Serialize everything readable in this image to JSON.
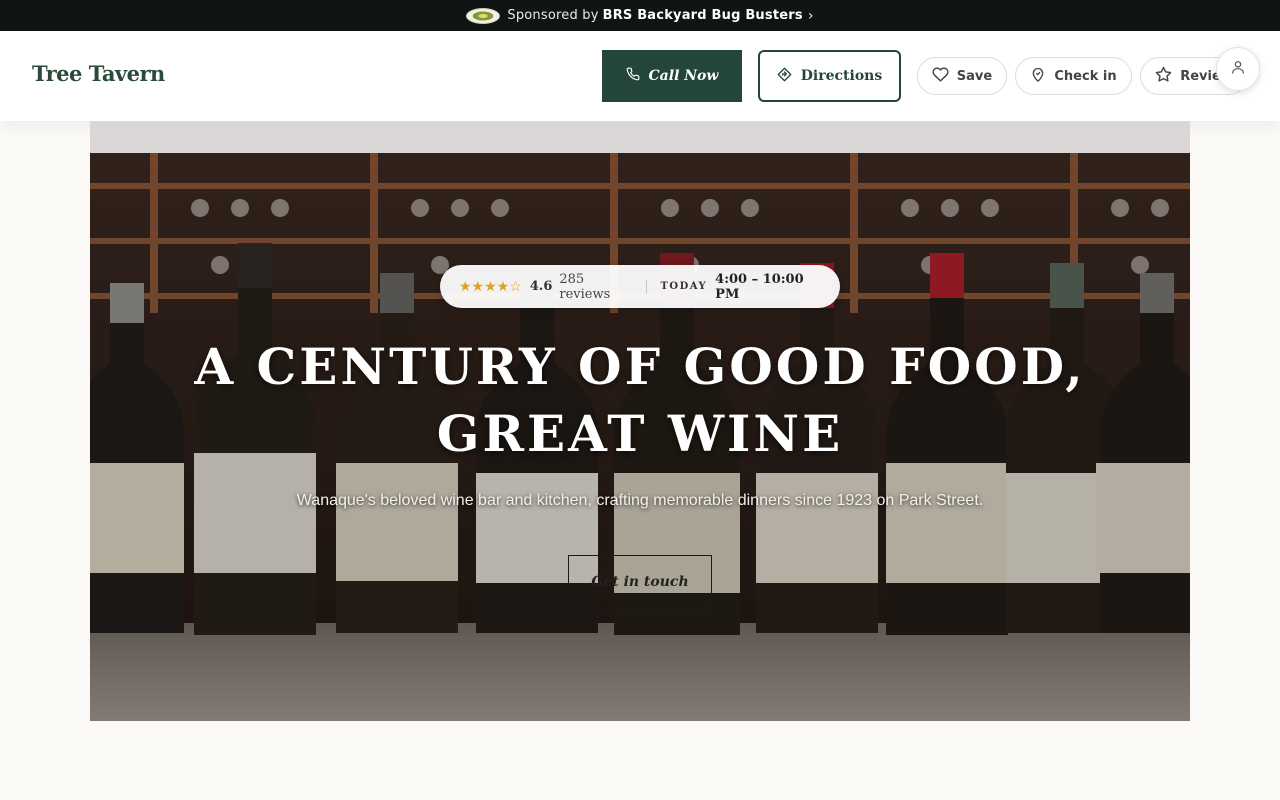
{
  "sponsor": {
    "prefix": "Sponsored by",
    "name": "BRS Backyard Bug Busters",
    "chevron": "›",
    "logo_icon": "sponsor-logo"
  },
  "header": {
    "brand": "Tree Tavern",
    "call_label": "Call Now",
    "directions_label": "Directions",
    "save_label": "Save",
    "checkin_label": "Check in",
    "review_label": "Review",
    "accent": "#24453a"
  },
  "hero": {
    "stars": "★★★★☆",
    "rating": "4.6",
    "reviews": "285 reviews",
    "today_label": "TODAY",
    "hours": "4:00 – 10:00 PM",
    "title_line1": "A CENTURY OF GOOD FOOD,",
    "title_line2": "GREAT WINE",
    "subtitle": "Wanaque's beloved wine bar and kitchen, crafting memorable dinners since 1923 on Park Street.",
    "cta_label": "Get in touch"
  }
}
